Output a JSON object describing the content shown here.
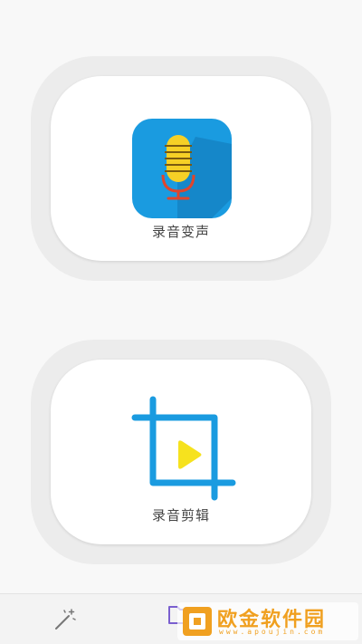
{
  "cards": [
    {
      "label": "录音变声",
      "icon": "microphone-icon"
    },
    {
      "label": "录音剪辑",
      "icon": "crop-play-icon"
    }
  ],
  "bottom_bar": {
    "items": [
      {
        "icon": "magic-wand-icon"
      },
      {
        "icon": "folder-icon"
      }
    ]
  },
  "watermark": {
    "text": "欧金软件园",
    "url": "www.apoujin.com"
  },
  "colors": {
    "icon_blue": "#1a9be0",
    "mic_yellow": "#f6d026",
    "mic_red": "#e0452c",
    "play_yellow": "#f6e21e",
    "watermark_orange": "#f0a020"
  }
}
